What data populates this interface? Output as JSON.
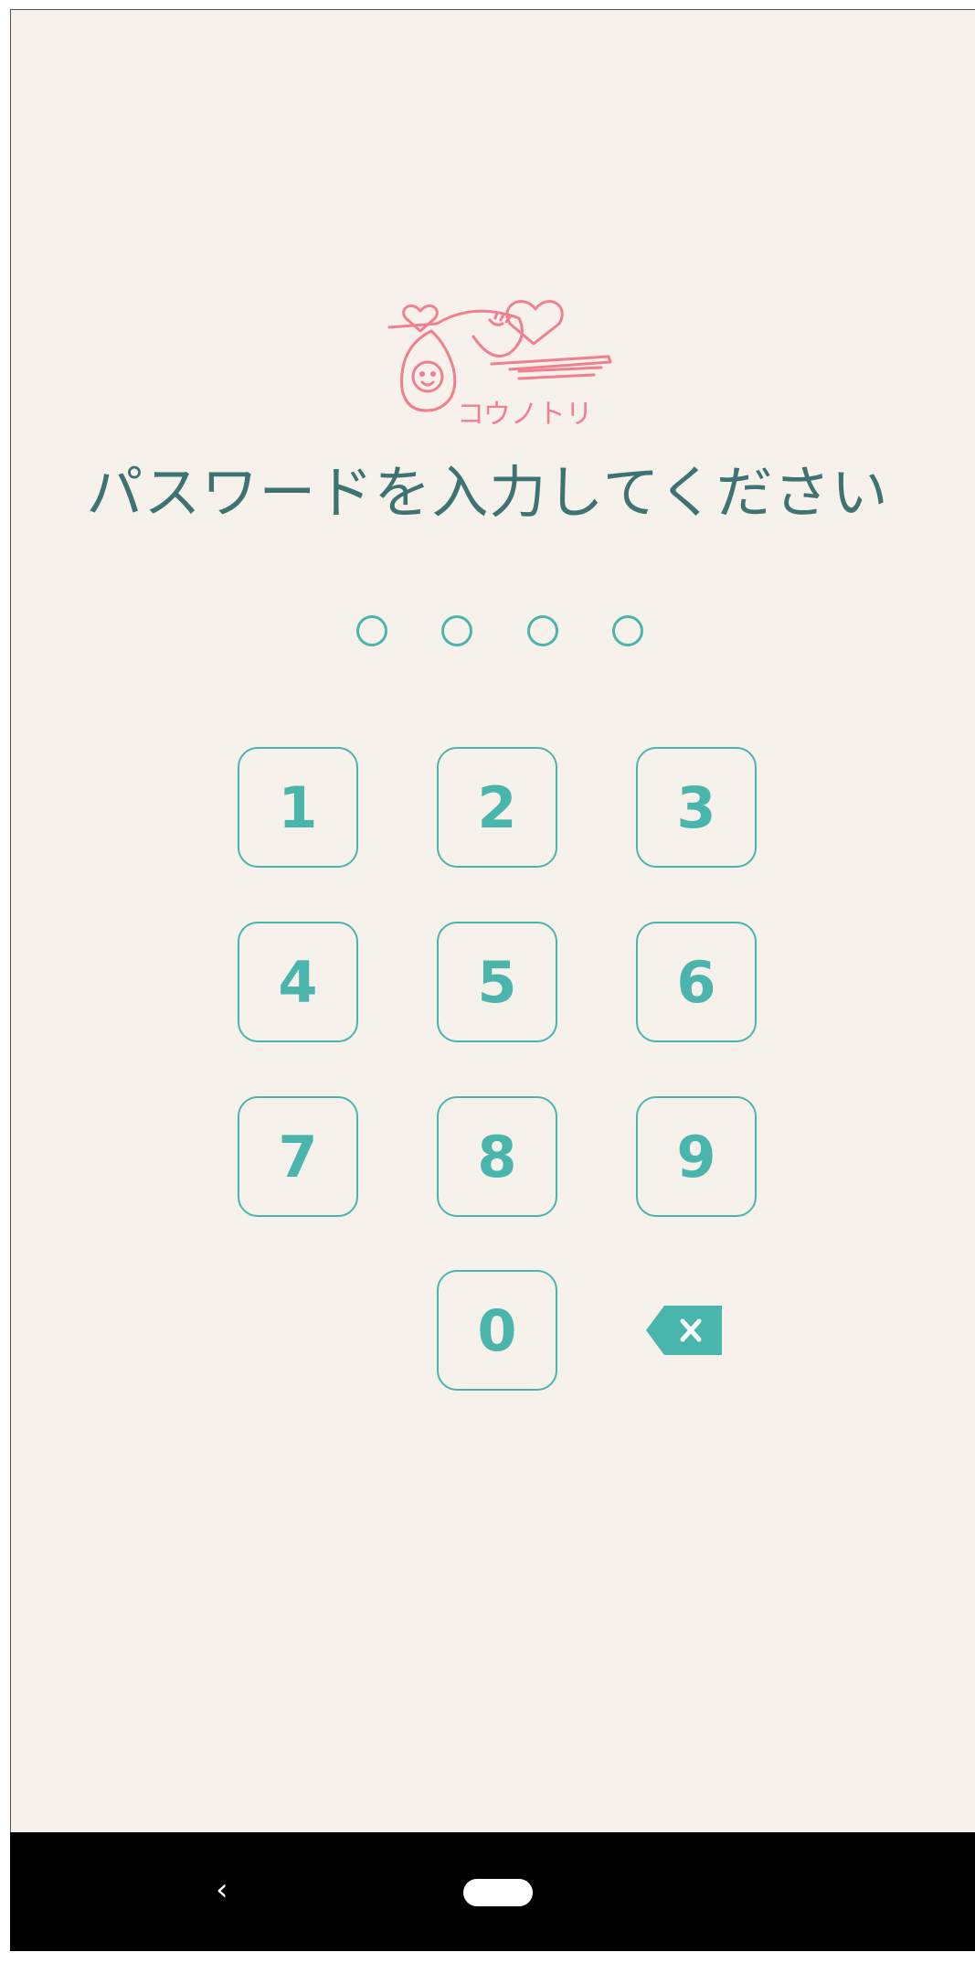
{
  "app": {
    "logo_text": "コウノトリ",
    "title": "パスワードを入力してください"
  },
  "pin": {
    "length": 4,
    "filled": 0
  },
  "keypad": {
    "keys": [
      "1",
      "2",
      "3",
      "4",
      "5",
      "6",
      "7",
      "8",
      "9",
      "0"
    ],
    "backspace_icon": "backspace-icon"
  },
  "navigation": {
    "back_label": "‹",
    "home_icon": "home-pill-icon"
  },
  "colors": {
    "accent": "#4ab5ad",
    "title": "#3e7373",
    "logo": "#f07f8f",
    "background": "#f6f1ea"
  }
}
